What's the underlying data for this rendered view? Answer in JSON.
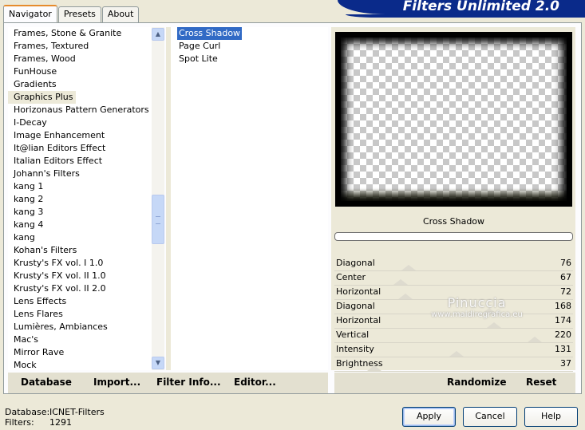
{
  "tabs": [
    {
      "label": "Navigator",
      "active": true
    },
    {
      "label": "Presets",
      "active": false
    },
    {
      "label": "About",
      "active": false
    }
  ],
  "banner": "Filters Unlimited 2.0",
  "categories": [
    "Frames, Stone & Granite",
    "Frames, Textured",
    "Frames, Wood",
    "FunHouse",
    "Gradients",
    "Graphics Plus",
    "Horizonaus Pattern Generators",
    "I-Decay",
    "Image Enhancement",
    "It@lian Editors Effect",
    "Italian Editors Effect",
    "Johann's Filters",
    "kang 1",
    "kang 2",
    "kang 3",
    "kang 4",
    "kang",
    "Kohan's Filters",
    "Krusty's FX vol. I 1.0",
    "Krusty's FX vol. II 1.0",
    "Krusty's FX vol. II 2.0",
    "Lens Effects",
    "Lens Flares",
    "Lumières, Ambiances",
    "Mac's",
    "Mirror Rave",
    "Mock"
  ],
  "selected_category": "Graphics Plus",
  "filters": [
    "Cross Shadow",
    "Page Curl",
    "Spot Lite"
  ],
  "selected_filter": "Cross Shadow",
  "filter_title": "Cross Shadow",
  "sliders": [
    {
      "label": "Diagonal",
      "value": 76
    },
    {
      "label": "Center",
      "value": 67
    },
    {
      "label": "Horizontal",
      "value": 72
    },
    {
      "label": "Diagonal",
      "value": 168
    },
    {
      "label": "Horizontal",
      "value": 174
    },
    {
      "label": "Vertical",
      "value": 220
    },
    {
      "label": "Intensity",
      "value": 131
    },
    {
      "label": "Brightness",
      "value": 37
    }
  ],
  "watermark": {
    "line1": "Pinuccia",
    "line2": "www.maidiregrafica.eu"
  },
  "left_buttons": [
    "Database",
    "Import...",
    "Filter Info...",
    "Editor..."
  ],
  "right_buttons": [
    "Randomize",
    "Reset"
  ],
  "status": {
    "database_label": "Database:",
    "database_value": "ICNET-Filters",
    "filters_label": "Filters:",
    "filters_value": "1291"
  },
  "dialog_buttons": {
    "apply": "Apply",
    "cancel": "Cancel",
    "help": "Help"
  }
}
